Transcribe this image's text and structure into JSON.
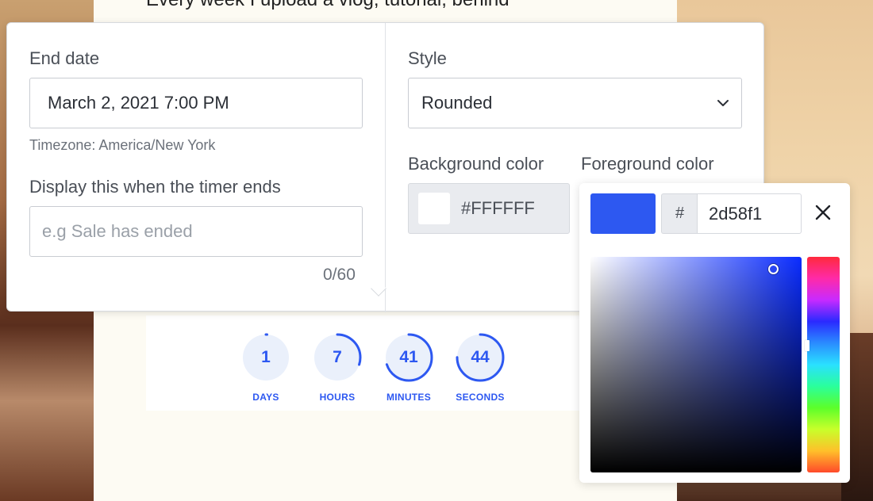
{
  "page": {
    "headline": "Every week I upload a vlog, tutorial, behind"
  },
  "settings": {
    "end_date": {
      "label": "End date",
      "value": "March 2, 2021 7:00 PM",
      "timezone_text": "Timezone: America/New York"
    },
    "ended_message": {
      "label": "Display this when the timer ends",
      "placeholder": "e.g Sale has ended",
      "value": "",
      "counter": "0/60"
    },
    "style": {
      "label": "Style",
      "selected": "Rounded"
    },
    "background_color": {
      "label": "Background color",
      "hex": "#FFFFFF",
      "swatch": "#FFFFFF"
    },
    "foreground_color": {
      "label": "Foreground color"
    }
  },
  "color_picker": {
    "preview_color": "#2d58f1",
    "hash_prefix": "#",
    "hex_value": "2d58f1",
    "icons": {
      "close": "close-icon"
    }
  },
  "countdown": {
    "accent_color": "#2d58f1",
    "units": [
      {
        "value": "1",
        "label": "DAYS",
        "progress": 0.0
      },
      {
        "value": "7",
        "label": "HOURS",
        "progress": 0.3
      },
      {
        "value": "41",
        "label": "MINUTES",
        "progress": 0.7
      },
      {
        "value": "44",
        "label": "SECONDS",
        "progress": 0.75
      }
    ]
  }
}
